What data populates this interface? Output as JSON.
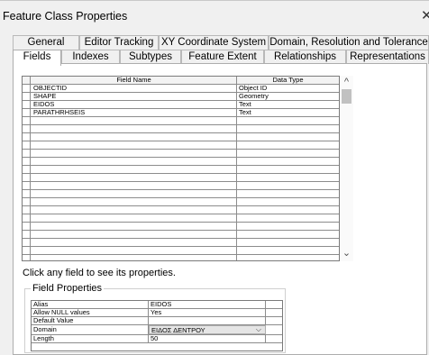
{
  "window": {
    "title": "Feature Class Properties",
    "close_glyph": "✕"
  },
  "tabs": {
    "back_row": [
      "General",
      "Editor Tracking",
      "XY Coordinate System",
      "Domain, Resolution and Tolerance"
    ],
    "front_row": [
      "Fields",
      "Indexes",
      "Subtypes",
      "Feature Extent",
      "Relationships",
      "Representations"
    ],
    "active": "Fields"
  },
  "fields_table": {
    "columns": [
      "Field Name",
      "Data Type"
    ],
    "rows": [
      {
        "name": "OBJECTID",
        "type": "Object ID"
      },
      {
        "name": "SHAPE",
        "type": "Geometry"
      },
      {
        "name": "EIDOS",
        "type": "Text"
      },
      {
        "name": "PARATHRHSEIS",
        "type": "Text"
      }
    ],
    "scroll_up_glyph": "^",
    "scroll_down_glyph": "⌄"
  },
  "hint": "Click any field to see its properties.",
  "field_properties": {
    "legend": "Field Properties",
    "rows": [
      {
        "key": "Alias",
        "value": "EIDOS"
      },
      {
        "key": "Allow NULL values",
        "value": "Yes"
      },
      {
        "key": "Default Value",
        "value": ""
      },
      {
        "key": "Domain",
        "value": "ΕΙΔΟΣ ΔΕΝΤΡΟΥ"
      },
      {
        "key": "Length",
        "value": "50"
      }
    ],
    "dropdown_chevron": "⌵"
  }
}
